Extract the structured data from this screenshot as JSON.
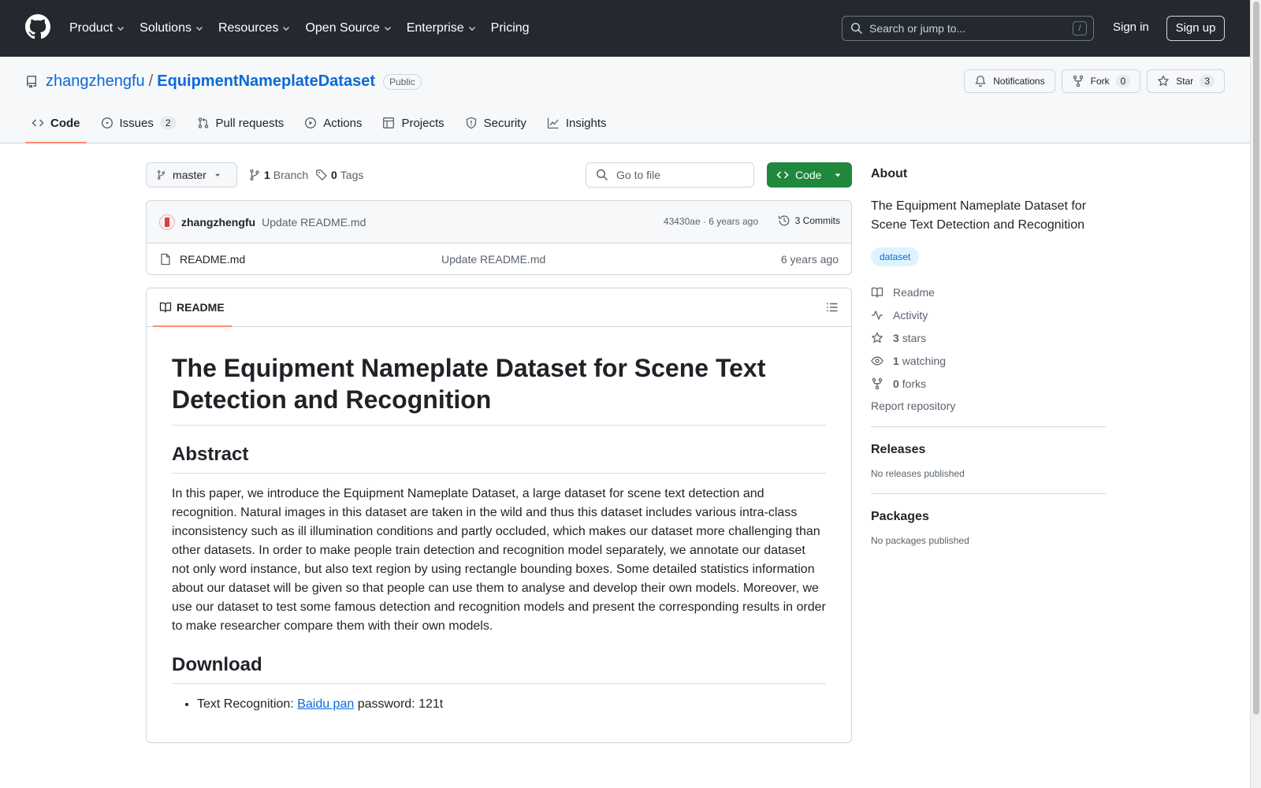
{
  "header": {
    "nav": [
      "Product",
      "Solutions",
      "Resources",
      "Open Source",
      "Enterprise",
      "Pricing"
    ],
    "search_placeholder": "Search or jump to...",
    "search_key": "/",
    "sign_in": "Sign in",
    "sign_up": "Sign up"
  },
  "repo": {
    "owner": "zhangzhengfu",
    "separator": "/",
    "name": "EquipmentNameplateDataset",
    "visibility": "Public",
    "notifications_label": "Notifications",
    "fork_label": "Fork",
    "fork_count": "0",
    "star_label": "Star",
    "star_count": "3"
  },
  "tabs": [
    {
      "label": "Code",
      "icon": "code-icon"
    },
    {
      "label": "Issues",
      "count": "2",
      "icon": "issue-icon"
    },
    {
      "label": "Pull requests",
      "icon": "pull-request-icon"
    },
    {
      "label": "Actions",
      "icon": "play-icon"
    },
    {
      "label": "Projects",
      "icon": "table-icon"
    },
    {
      "label": "Security",
      "icon": "shield-icon"
    },
    {
      "label": "Insights",
      "icon": "graph-icon"
    }
  ],
  "toolbar": {
    "branch": "master",
    "branch_count": "1",
    "branch_label": "Branch",
    "tag_count": "0",
    "tag_label": "Tags",
    "goto_placeholder": "Go to file",
    "code_label": "Code"
  },
  "commit": {
    "author": "zhangzhengfu",
    "message": "Update README.md",
    "meta": "43430ae · 6 years ago",
    "commits_label": "3 Commits"
  },
  "files": [
    {
      "name": "README.md",
      "message": "Update README.md",
      "age": "6 years ago"
    }
  ],
  "readme": {
    "tab_label": "README",
    "title": "The Equipment Nameplate Dataset for Scene Text Detection and Recognition",
    "abstract_heading": "Abstract",
    "abstract": "In this paper, we introduce the Equipment Nameplate Dataset, a large dataset for scene text detection and recognition. Natural images in this dataset are taken in the wild and thus this dataset includes various intra-class inconsistency such as ill illumination conditions and partly occluded, which makes our dataset more challenging than other datasets. In order to make people train detection and recognition model separately, we annotate our dataset not only word instance, but also text region by using rectangle bounding boxes. Some detailed statistics information about our dataset will be given so that people can use them to analyse and develop their own models. Moreover, we use our dataset to test some famous detection and recognition models and present the corresponding results in order to make researcher compare them with their own models.",
    "download_heading": "Download",
    "download_prefix": "Text Recognition: ",
    "download_link": "Baidu pan",
    "download_suffix": " password: 121t"
  },
  "about": {
    "heading": "About",
    "description": "The Equipment Nameplate Dataset for Scene Text Detection and Recognition",
    "topic": "dataset",
    "readme": "Readme",
    "activity": "Activity",
    "stars_count": "3",
    "stars_label": "stars",
    "watching_count": "1",
    "watching_label": "watching",
    "forks_count": "0",
    "forks_label": "forks",
    "report": "Report repository",
    "releases_heading": "Releases",
    "releases_text": "No releases published",
    "packages_heading": "Packages",
    "packages_text": "No packages published"
  }
}
